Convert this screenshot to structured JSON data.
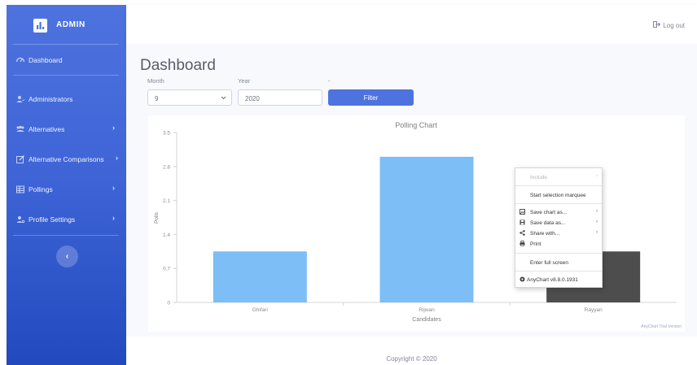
{
  "brand": {
    "name": "ADMIN"
  },
  "sidebar": {
    "items": [
      {
        "label": "Dashboard",
        "icon": "dashboard-icon",
        "has_submenu": false
      },
      {
        "label": "Administrators",
        "icon": "users-icon",
        "has_submenu": false
      },
      {
        "label": "Alternatives",
        "icon": "people-icon",
        "has_submenu": true
      },
      {
        "label": "Alternative Comparisons",
        "icon": "edit-icon",
        "has_submenu": true
      },
      {
        "label": "Pollings",
        "icon": "table-icon",
        "has_submenu": true
      },
      {
        "label": "Profile Settings",
        "icon": "user-cog-icon",
        "has_submenu": true
      }
    ],
    "toggle_glyph": "‹",
    "chevron": "›"
  },
  "topbar": {
    "logout_label": "Log out"
  },
  "main": {
    "title": "Dashboard",
    "filter": {
      "month_label": "Month",
      "month_value": "9",
      "year_label": "Year",
      "year_value": "2020",
      "extra_label": "-",
      "button_label": "Filter"
    }
  },
  "chart_data": {
    "type": "bar",
    "title": "Polling Chart",
    "xlabel": "Candidates",
    "ylabel": "Polls",
    "categories": [
      "Ghifari",
      "Rijwan",
      "Rayyan"
    ],
    "values": [
      1.05,
      3.0,
      1.05
    ],
    "bar_colors": [
      "#7cbef5",
      "#7cbef5",
      "#4d4d4d"
    ],
    "ylim": [
      0,
      3.5
    ],
    "yticks": [
      "0",
      "0.7",
      "1.4",
      "2.1",
      "2.8",
      "3.5"
    ],
    "watermark": "AnyChart Trial Version"
  },
  "context_menu": {
    "items": [
      {
        "label": "Include",
        "disabled": true,
        "arrow": true,
        "icon": ""
      },
      {
        "label": "Start selection marquee",
        "disabled": false,
        "arrow": false,
        "icon": ""
      },
      {
        "label": "Save chart as...",
        "disabled": false,
        "arrow": true,
        "icon": "image-icon"
      },
      {
        "label": "Save data as...",
        "disabled": false,
        "arrow": true,
        "icon": "save-icon"
      },
      {
        "label": "Share with...",
        "disabled": false,
        "arrow": true,
        "icon": "share-icon"
      },
      {
        "label": "Print",
        "disabled": false,
        "arrow": false,
        "icon": "print-icon"
      },
      {
        "label": "Enter full screen",
        "disabled": false,
        "arrow": false,
        "icon": ""
      },
      {
        "label": "AnyChart v8.8.0.1931",
        "disabled": false,
        "arrow": false,
        "icon": "anychart-icon"
      }
    ],
    "arrow_glyph": "›"
  },
  "footer": {
    "copyright": "Copyright © 2020"
  },
  "colors": {
    "primary": "#4e73df",
    "sidebar_dark": "#224abe",
    "bar": "#7cbef5",
    "bar_selected": "#4d4d4d"
  }
}
